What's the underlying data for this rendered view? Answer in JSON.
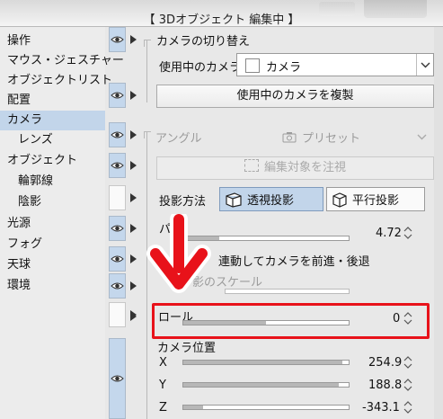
{
  "window": {
    "title": "【 3Dオブジェクト 編集中 】"
  },
  "sidebar": {
    "items": [
      {
        "label": "操作",
        "eye": "on",
        "play": true
      },
      {
        "label": "マウス・ジェスチャー",
        "eye": "none",
        "play": false
      },
      {
        "label": "オブジェクトリスト",
        "eye": "none",
        "play": false
      },
      {
        "label": "配置",
        "eye": "on",
        "play": true
      },
      {
        "label": "カメラ",
        "eye": "none",
        "play": false,
        "active": true
      },
      {
        "label": "レンズ",
        "eye": "on",
        "play": true,
        "sub": true
      },
      {
        "label": "オブジェクト",
        "eye": "on",
        "play": true
      },
      {
        "label": "輪郭線",
        "eye": "none",
        "play": false,
        "sub": true
      },
      {
        "label": "陰影",
        "eye": "off",
        "play": true,
        "sub": true
      },
      {
        "label": "光源",
        "eye": "on",
        "play": true
      },
      {
        "label": "フォグ",
        "eye": "on",
        "play": true
      },
      {
        "label": "天球",
        "eye": "on",
        "play": true
      },
      {
        "label": "環境",
        "eye": "off",
        "play": true
      }
    ]
  },
  "camera_switch": {
    "heading": "カメラの切り替え",
    "active_camera_label": "使用中のカメラ",
    "active_camera_value": "カメラ",
    "duplicate_button": "使用中のカメラを複製"
  },
  "angle": {
    "label": "アングル",
    "preset_label": "プリセット",
    "focus_button": "編集対象を注視"
  },
  "projection": {
    "label": "投影方法",
    "perspective": "透視投影",
    "parallel": "平行投影"
  },
  "params": {
    "pa_label": "パ",
    "pa_value": "4.72",
    "pa_fill": 0.22,
    "link_label": "連動してカメラを前進・後退",
    "scale_label": "影のスケール",
    "roll_label": "ロール",
    "roll_value": "0",
    "roll_fill": 0.5
  },
  "camera_position": {
    "heading": "カメラ位置",
    "x_label": "X",
    "x_value": "254.9",
    "x_fill": 0.96,
    "y_label": "Y",
    "y_value": "188.8",
    "y_fill": 0.94,
    "z_label": "Z",
    "z_value": "-343.1",
    "z_fill": 0.12
  },
  "colors": {
    "highlight": "#e8121a",
    "selection": "#c2d5ea"
  }
}
